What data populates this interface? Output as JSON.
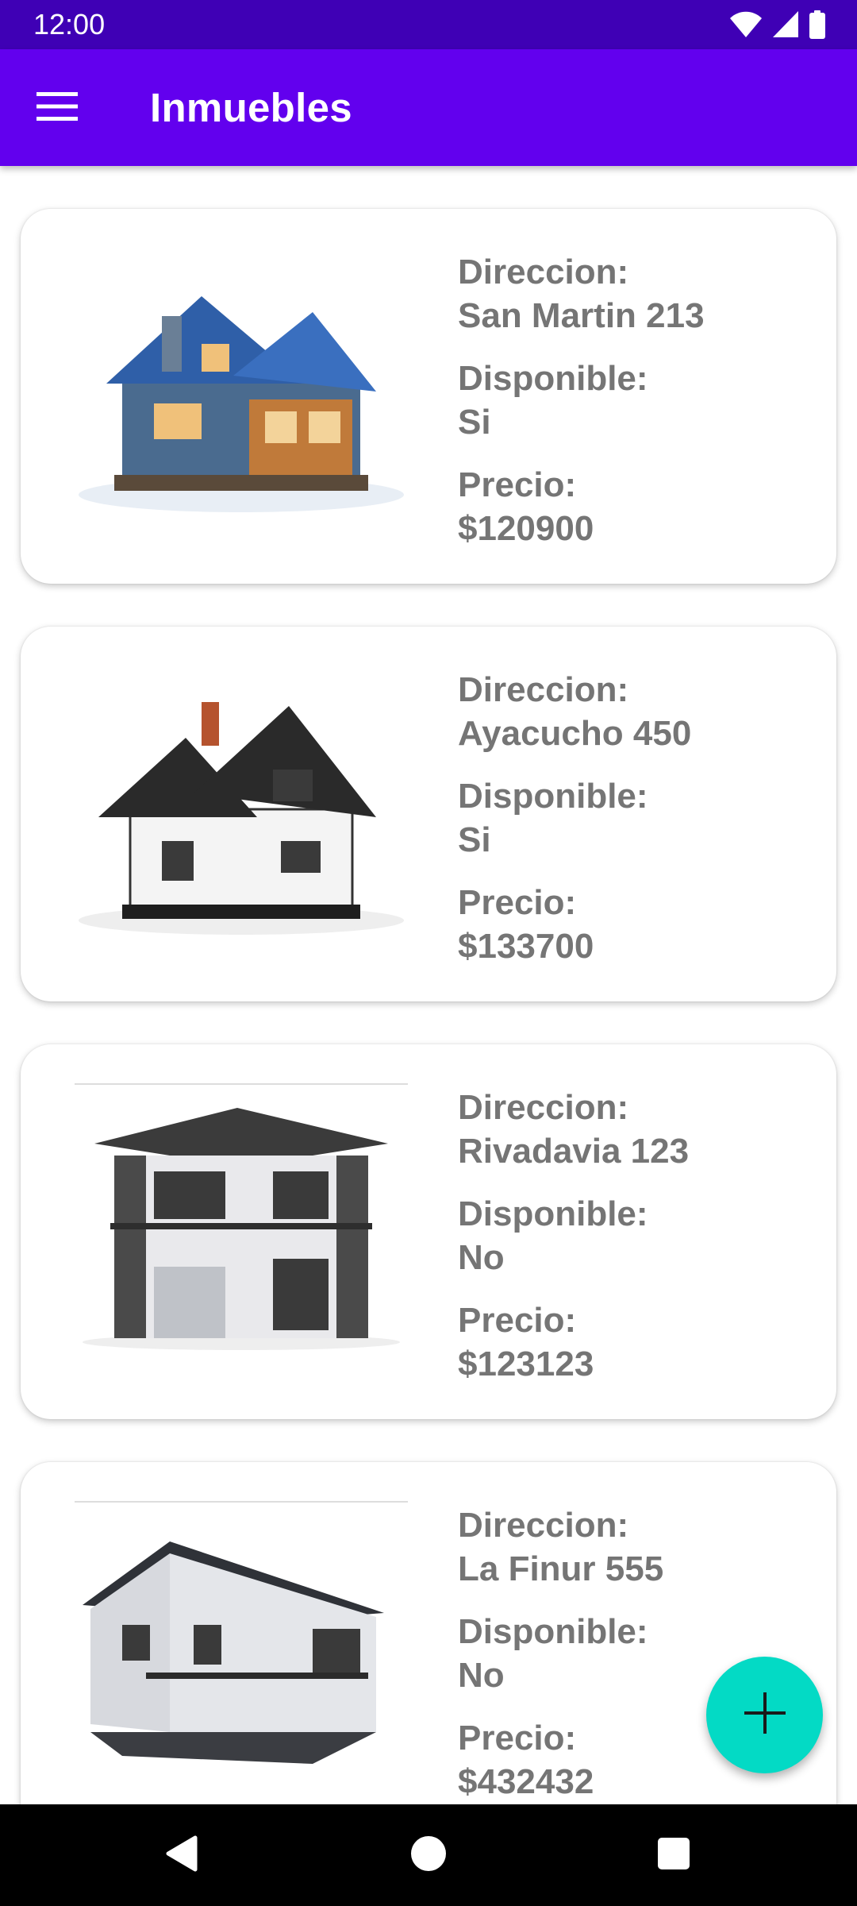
{
  "status_bar": {
    "time": "12:00",
    "icons": [
      "wifi-icon",
      "signal-icon",
      "battery-icon"
    ]
  },
  "app_bar": {
    "title": "Inmuebles",
    "menu_icon": "hamburger-menu-icon",
    "color": "#6200ee"
  },
  "colors": {
    "status_bar": "#3f00b5",
    "app_bar": "#6200ee",
    "fab": "#03dac5",
    "text_secondary": "#757575"
  },
  "inmuebles": [
    {
      "direccion_label": "Direccion:",
      "direccion": "San Martin 213",
      "disponible_label": "Disponible:",
      "disponible": "Si",
      "precio_label": "Precio:",
      "precio": "$120900",
      "image": "house-photo-icon"
    },
    {
      "direccion_label": "Direccion:",
      "direccion": "Ayacucho 450",
      "disponible_label": "Disponible:",
      "disponible": "Si",
      "precio_label": "Precio:",
      "precio": "$133700",
      "image": "house-photo-icon"
    },
    {
      "direccion_label": "Direccion:",
      "direccion": "Rivadavia 123",
      "disponible_label": "Disponible:",
      "disponible": "No",
      "precio_label": "Precio:",
      "precio": "$123123",
      "image": "house-photo-icon"
    },
    {
      "direccion_label": "Direccion:",
      "direccion": "La Finur 555",
      "disponible_label": "Disponible:",
      "disponible": "No",
      "precio_label": "Precio:",
      "precio": "$432432",
      "image": "house-photo-icon"
    }
  ],
  "fab": {
    "icon": "plus-icon"
  },
  "nav_bar": {
    "icons": [
      "back-icon",
      "home-icon",
      "recents-icon"
    ]
  }
}
